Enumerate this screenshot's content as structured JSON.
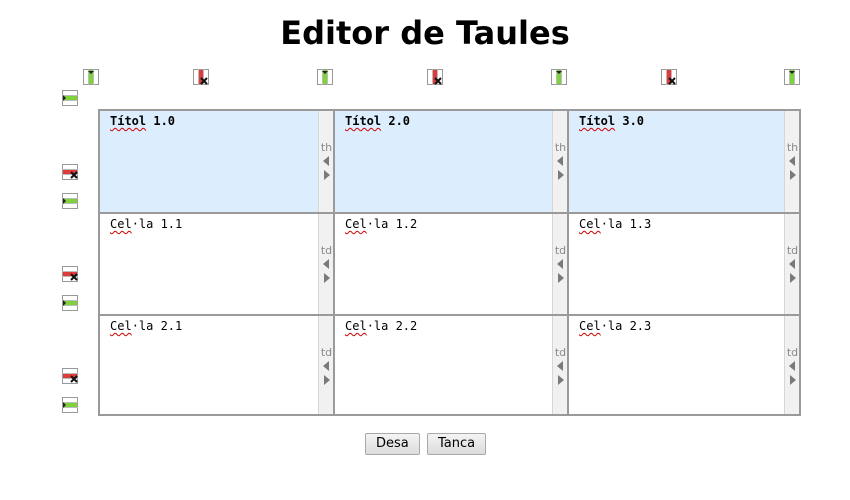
{
  "page_title": "Editor de Taules",
  "icons": {
    "insert_column": "insert-column-icon",
    "delete_column": "delete-column-icon",
    "insert_row": "insert-row-icon",
    "delete_row": "delete-row-icon"
  },
  "table": {
    "rows": [
      {
        "cells": [
          {
            "type": "th",
            "word": "Títol",
            "num": "1.0"
          },
          {
            "type": "th",
            "word": "Títol",
            "num": "2.0"
          },
          {
            "type": "th",
            "word": "Títol",
            "num": "3.0"
          }
        ]
      },
      {
        "cells": [
          {
            "type": "td",
            "word": "Cel",
            "num": "·la 1.1"
          },
          {
            "type": "td",
            "word": "Cel",
            "num": "·la 1.2"
          },
          {
            "type": "td",
            "word": "Cel",
            "num": "·la 1.3"
          }
        ]
      },
      {
        "cells": [
          {
            "type": "td",
            "word": "Cel",
            "num": "·la 2.1"
          },
          {
            "type": "td",
            "word": "Cel",
            "num": "·la 2.2"
          },
          {
            "type": "td",
            "word": "Cel",
            "num": "·la 2.3"
          }
        ]
      }
    ]
  },
  "buttons": {
    "save": "Desa",
    "close": "Tanca"
  },
  "colors": {
    "header_bg": "#dcedfe",
    "border": "#9a9a9a",
    "insert_green": "#7ed23a",
    "delete_red": "#e03a3a"
  }
}
